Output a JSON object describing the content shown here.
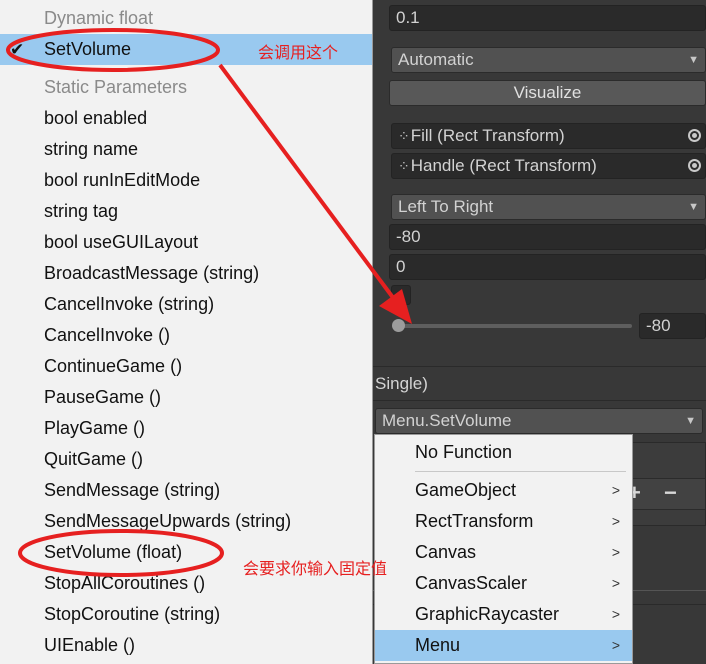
{
  "inspector": {
    "value_field": "0.1",
    "navigation_dropdown": "Automatic",
    "visualize_button": "Visualize",
    "fill_rect": "Fill (Rect Transform)",
    "handle_rect": "Handle (Rect Transform)",
    "direction_dropdown": "Left To Right",
    "min_value": "-80",
    "max_value": "0",
    "slider_value_label": "-80",
    "slider_value_fraction": 0.0,
    "event_header": "Single)",
    "function_dropdown": "Menu.SetVolume",
    "plus_label": "+",
    "minus_label": "−"
  },
  "menu_left": {
    "dynamic_header": "Dynamic float",
    "selected_item": "SetVolume",
    "static_header": "Static Parameters",
    "items": [
      "bool enabled",
      "string name",
      "bool runInEditMode",
      "string tag",
      "bool useGUILayout",
      "BroadcastMessage (string)",
      "CancelInvoke (string)",
      "CancelInvoke ()",
      "ContinueGame ()",
      "PauseGame ()",
      "PlayGame ()",
      "QuitGame ()",
      "SendMessage (string)",
      "SendMessageUpwards (string)",
      "SetVolume (float)",
      "StopAllCoroutines ()",
      "StopCoroutine (string)",
      "UIEnable ()"
    ]
  },
  "menu_right": {
    "no_function": "No Function",
    "items": [
      "GameObject",
      "RectTransform",
      "Canvas",
      "CanvasScaler",
      "GraphicRaycaster",
      "Menu"
    ]
  },
  "annotations": {
    "note_top": "会调用这个",
    "note_bottom": "会要求你输入固定值",
    "color": "#e62020"
  },
  "colors": {
    "selection": "#99c9ef",
    "menu_bg": "#f2f2f2",
    "inspector_bg": "#383838"
  }
}
